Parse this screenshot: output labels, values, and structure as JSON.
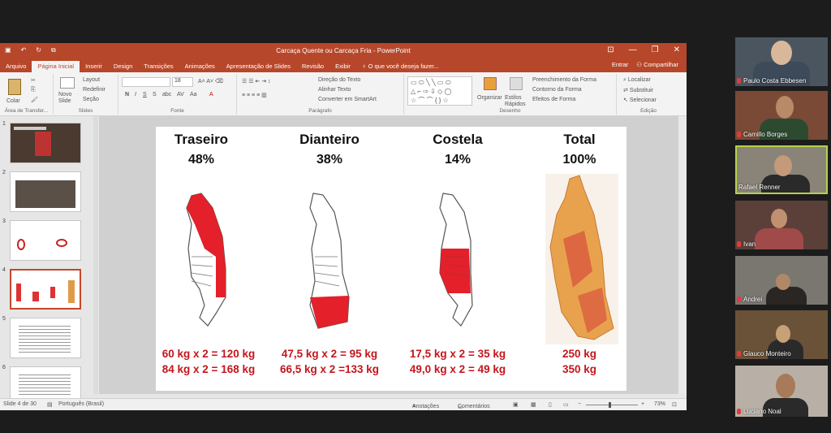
{
  "window": {
    "title": "Carcaça Quente ou Carcaça Fria - PowerPoint",
    "controls": [
      "⊡",
      "—",
      "❐",
      "✕"
    ]
  },
  "tabs": [
    "Arquivo",
    "Página Inicial",
    "Inserir",
    "Design",
    "Transições",
    "Animações",
    "Apresentação de Slides",
    "Revisão",
    "Exibir"
  ],
  "tell_me": "O que você deseja fazer...",
  "account": {
    "signin": "Entrar",
    "share": "Compartilhar"
  },
  "ribbon": {
    "clipboard": {
      "paste": "Colar",
      "label": "Área de Transfer..."
    },
    "slides": {
      "new_slide": "Novo Slide",
      "layout": "Layout",
      "reset": "Redefinir",
      "section": "Seção",
      "label": "Slides"
    },
    "font": {
      "size": "18",
      "label": "Fonte"
    },
    "paragraph": {
      "direction": "Direção do Texto",
      "align": "Alinhar Texto",
      "smartart": "Converter em SmartArt",
      "label": "Parágrafo"
    },
    "drawing": {
      "arrange": "Organizar",
      "styles": "Estilos Rápidos",
      "fill": "Preenchimento da Forma",
      "outline": "Contorno da Forma",
      "effects": "Efeitos de Forma",
      "label": "Desenho"
    },
    "editing": {
      "find": "Localizar",
      "replace": "Substituir",
      "select": "Selecionar",
      "label": "Edição"
    }
  },
  "thumbnails": [
    "1",
    "2",
    "3",
    "4",
    "5",
    "6"
  ],
  "slide": {
    "columns": [
      {
        "title": "Traseiro",
        "pct": "48%",
        "line1": "60 kg x 2 = 120 kg",
        "line2": "84 kg x 2 = 168 kg"
      },
      {
        "title": "Dianteiro",
        "pct": "38%",
        "line1": "47,5 kg x 2 = 95 kg",
        "line2": "66,5 kg x 2 =133 kg"
      },
      {
        "title": "Costela",
        "pct": "14%",
        "line1": "17,5 kg x 2 = 35 kg",
        "line2": "49,0 kg x 2 = 49 kg"
      },
      {
        "title": "Total",
        "pct": "100%",
        "line1": "250 kg",
        "line2": "350 kg"
      }
    ],
    "highlight_color": "#e4202a"
  },
  "status": {
    "slide_info": "Slide 4 de 30",
    "language": "Português (Brasil)",
    "notes": "Anotações",
    "comments": "Comentários",
    "zoom": "73%"
  },
  "participants": [
    {
      "name": "Paulo Costa Ebbesen"
    },
    {
      "name": "Camillo Borges"
    },
    {
      "name": "Rafael Renner"
    },
    {
      "name": "Ivan"
    },
    {
      "name": "Andrei"
    },
    {
      "name": "Glauco Monteiro"
    },
    {
      "name": "Luciano Noal"
    }
  ]
}
